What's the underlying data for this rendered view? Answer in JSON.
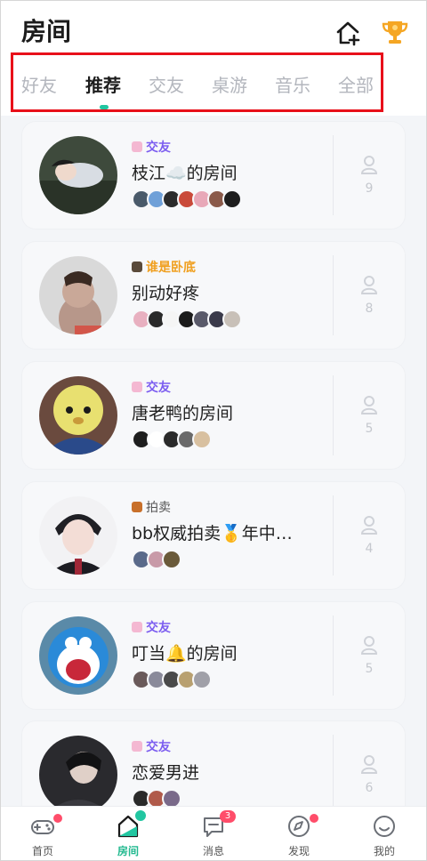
{
  "header": {
    "title": "房间"
  },
  "tabs": [
    {
      "label": "好友",
      "active": false
    },
    {
      "label": "推荐",
      "active": true
    },
    {
      "label": "交友",
      "active": false
    },
    {
      "label": "桌游",
      "active": false
    },
    {
      "label": "音乐",
      "active": false
    },
    {
      "label": "全部",
      "active": false
    }
  ],
  "rooms": [
    {
      "tag": "交友",
      "tag_color": "#7b5cf0",
      "tag_icon_color": "#f4b8d2",
      "name": "枝江☁️的房间",
      "online": "9"
    },
    {
      "tag": "谁是卧底",
      "tag_color": "#f0a020",
      "tag_icon_color": "#5a4a3a",
      "name": "别动好疼",
      "online": "8"
    },
    {
      "tag": "交友",
      "tag_color": "#7b5cf0",
      "tag_icon_color": "#f4b8d2",
      "name": "唐老鸭的房间",
      "online": "5"
    },
    {
      "tag": "拍卖",
      "tag_color": "#555555",
      "tag_icon_color": "#c8702a",
      "name": "bb权威拍卖🥇年中…",
      "online": "4"
    },
    {
      "tag": "交友",
      "tag_color": "#7b5cf0",
      "tag_icon_color": "#f4b8d2",
      "name": "叮当🔔的房间",
      "online": "5"
    },
    {
      "tag": "交友",
      "tag_color": "#7b5cf0",
      "tag_icon_color": "#f4b8d2",
      "name": "恋爱男进",
      "online": "6"
    }
  ],
  "bottom_nav": [
    {
      "label": "首页",
      "icon": "gamepad-icon",
      "dot": true
    },
    {
      "label": "房间",
      "icon": "room-icon",
      "active": true
    },
    {
      "label": "消息",
      "icon": "message-icon",
      "badge": "3"
    },
    {
      "label": "发现",
      "icon": "compass-icon",
      "dot": true
    },
    {
      "label": "我的",
      "icon": "smile-icon"
    }
  ],
  "colors": {
    "accent": "#22c6a1",
    "highlight_border": "#e8101a"
  }
}
